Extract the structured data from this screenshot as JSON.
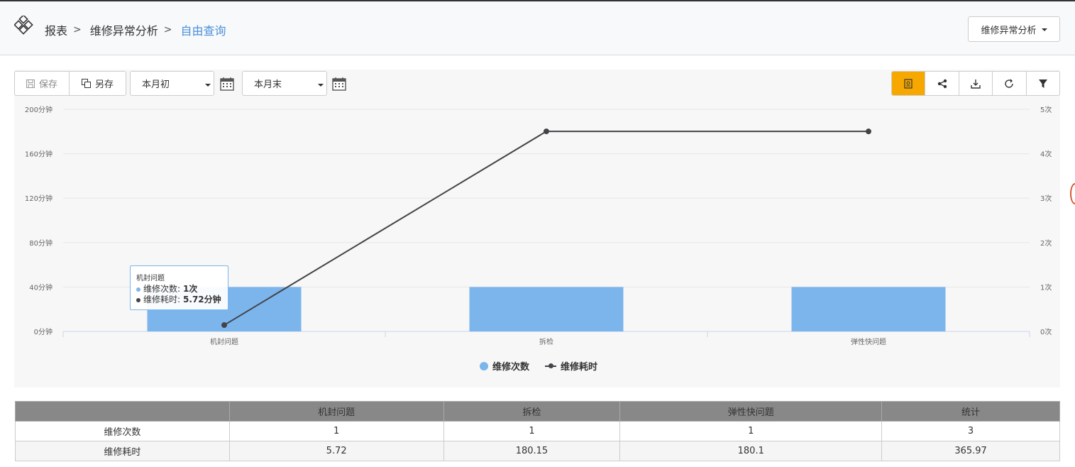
{
  "breadcrumb": {
    "items": [
      "报表",
      "维修异常分析"
    ],
    "active": "自由查询"
  },
  "header": {
    "report_dropdown_label": "维修异常分析"
  },
  "toolbar": {
    "save_label": "保存",
    "saveas_label": "另存",
    "start_date_value": "本月初",
    "end_date_value": "本月末"
  },
  "tools": [
    "report-icon",
    "share-icon",
    "download-icon",
    "refresh-icon",
    "filter-icon"
  ],
  "colors": {
    "bar": "#7cb5ec",
    "line": "#434348",
    "active_tool": "#f7a800",
    "breadcrumb_active": "#4a90d9"
  },
  "chart_data": {
    "type": "bar",
    "categories": [
      "机封问题",
      "拆检",
      "弹性快问题"
    ],
    "y_left": {
      "ticks": [
        "0分钟",
        "40分钟",
        "80分钟",
        "120分钟",
        "160分钟",
        "200分钟"
      ],
      "range": [
        0,
        200
      ]
    },
    "y_right": {
      "ticks": [
        "0次",
        "1次",
        "2次",
        "3次",
        "4次",
        "5次"
      ],
      "range": [
        0,
        5
      ]
    },
    "series": [
      {
        "name": "维修次数",
        "kind": "bar",
        "axis": "right",
        "values": [
          1,
          1,
          1
        ]
      },
      {
        "name": "维修耗时",
        "kind": "line",
        "axis": "left",
        "values": [
          5.72,
          180.15,
          180.1
        ]
      }
    ],
    "legend_position": "bottom-center",
    "grid": true
  },
  "tooltip": {
    "title": "机封问题",
    "row1_label": "维修次数: ",
    "row1_value": "1次",
    "row2_label": "维修耗时: ",
    "row2_value": "5.72分钟"
  },
  "table": {
    "headers": [
      "",
      "机封问题",
      "拆检",
      "弹性快问题",
      "统计"
    ],
    "rows": [
      [
        "维修次数",
        "1",
        "1",
        "1",
        "3"
      ],
      [
        "维修耗时",
        "5.72",
        "180.15",
        "180.1",
        "365.97"
      ]
    ]
  }
}
